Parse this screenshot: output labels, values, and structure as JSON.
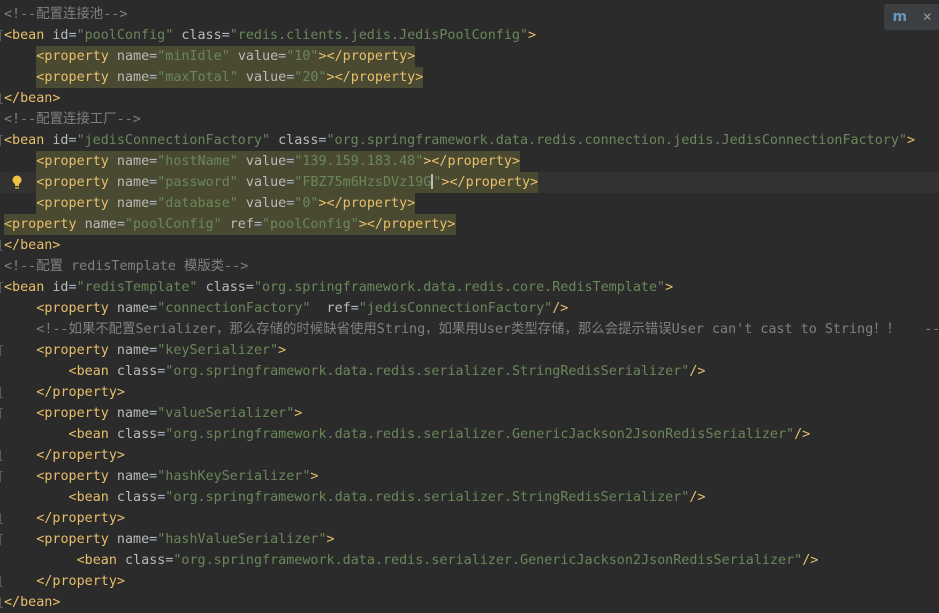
{
  "editor": {
    "lines": [
      {
        "indent": 0,
        "segs": [
          [
            "c",
            "<!--配置连接池-->"
          ]
        ]
      },
      {
        "indent": 0,
        "mark": "start",
        "segs": [
          [
            "t",
            "<bean"
          ],
          [
            "x",
            " "
          ],
          [
            "a",
            "id"
          ],
          [
            "x",
            "="
          ],
          [
            "v",
            "\"poolConfig\""
          ],
          [
            "x",
            " "
          ],
          [
            "a",
            "class"
          ],
          [
            "x",
            "="
          ],
          [
            "v",
            "\"redis.clients.jedis.JedisPoolConfig\""
          ],
          [
            "t",
            ">"
          ]
        ]
      },
      {
        "indent": 4,
        "hl": true,
        "segs": [
          [
            "t",
            "<property"
          ],
          [
            "x",
            " "
          ],
          [
            "a",
            "name"
          ],
          [
            "x",
            "="
          ],
          [
            "v",
            "\"minIdle\""
          ],
          [
            "x",
            " "
          ],
          [
            "a",
            "value"
          ],
          [
            "x",
            "="
          ],
          [
            "v",
            "\"10\""
          ],
          [
            "t",
            "></property>"
          ]
        ]
      },
      {
        "indent": 4,
        "hl": true,
        "segs": [
          [
            "t",
            "<property"
          ],
          [
            "x",
            " "
          ],
          [
            "a",
            "name"
          ],
          [
            "x",
            "="
          ],
          [
            "v",
            "\"maxTotal\""
          ],
          [
            "x",
            " "
          ],
          [
            "a",
            "value"
          ],
          [
            "x",
            "="
          ],
          [
            "v",
            "\"20\""
          ],
          [
            "t",
            "></property>"
          ]
        ]
      },
      {
        "indent": 0,
        "mark": "end",
        "segs": [
          [
            "t",
            "</bean>"
          ]
        ]
      },
      {
        "indent": 0,
        "segs": [
          [
            "c",
            "<!--配置连接工厂-->"
          ]
        ]
      },
      {
        "indent": 0,
        "mark": "start",
        "segs": [
          [
            "t",
            "<bean"
          ],
          [
            "x",
            " "
          ],
          [
            "a",
            "id"
          ],
          [
            "x",
            "="
          ],
          [
            "v",
            "\"jedisConnectionFactory\""
          ],
          [
            "x",
            " "
          ],
          [
            "a",
            "class"
          ],
          [
            "x",
            "="
          ],
          [
            "v",
            "\"org.springframework.data.redis.connection.jedis.JedisConnectionFactory\""
          ],
          [
            "t",
            ">"
          ]
        ]
      },
      {
        "indent": 4,
        "hl": true,
        "segs": [
          [
            "t",
            "<property"
          ],
          [
            "x",
            " "
          ],
          [
            "a",
            "name"
          ],
          [
            "x",
            "="
          ],
          [
            "v",
            "\"hostName\""
          ],
          [
            "x",
            " "
          ],
          [
            "a",
            "value"
          ],
          [
            "x",
            "="
          ],
          [
            "v",
            "\"139.159.183.48\""
          ],
          [
            "t",
            "></property>"
          ]
        ]
      },
      {
        "indent": 4,
        "hl": true,
        "caretRow": true,
        "bulb": true,
        "segs": [
          [
            "t",
            "<property"
          ],
          [
            "x",
            " "
          ],
          [
            "a",
            "name"
          ],
          [
            "x",
            "="
          ],
          [
            "v",
            "\"password\""
          ],
          [
            "x",
            " "
          ],
          [
            "a",
            "value"
          ],
          [
            "x",
            "="
          ],
          [
            "v",
            "\"FBZ75m6HzsDVz19G"
          ],
          [
            "caret",
            ""
          ],
          [
            "v",
            "\""
          ],
          [
            "t",
            "></property>"
          ]
        ]
      },
      {
        "indent": 4,
        "hl": true,
        "segs": [
          [
            "t",
            "<property"
          ],
          [
            "x",
            " "
          ],
          [
            "a",
            "name"
          ],
          [
            "x",
            "="
          ],
          [
            "v",
            "\"database\""
          ],
          [
            "x",
            " "
          ],
          [
            "a",
            "value"
          ],
          [
            "x",
            "="
          ],
          [
            "v",
            "\"0\""
          ],
          [
            "t",
            "></property>"
          ]
        ]
      },
      {
        "indent": 0,
        "hl": true,
        "segs": [
          [
            "t",
            "<property"
          ],
          [
            "x",
            " "
          ],
          [
            "a",
            "name"
          ],
          [
            "x",
            "="
          ],
          [
            "v",
            "\"poolConfig\""
          ],
          [
            "x",
            " "
          ],
          [
            "a",
            "ref"
          ],
          [
            "x",
            "="
          ],
          [
            "v",
            "\"poolConfig\""
          ],
          [
            "t",
            "></property>"
          ]
        ]
      },
      {
        "indent": 0,
        "mark": "end",
        "segs": [
          [
            "t",
            "</bean>"
          ]
        ]
      },
      {
        "indent": 0,
        "segs": [
          [
            "c",
            "<!--配置 redisTemplate 模版类-->"
          ]
        ]
      },
      {
        "indent": 0,
        "mark": "start",
        "segs": [
          [
            "t",
            "<bean"
          ],
          [
            "x",
            " "
          ],
          [
            "a",
            "id"
          ],
          [
            "x",
            "="
          ],
          [
            "v",
            "\"redisTemplate\""
          ],
          [
            "x",
            " "
          ],
          [
            "a",
            "class"
          ],
          [
            "x",
            "="
          ],
          [
            "v",
            "\"org.springframework.data.redis.core.RedisTemplate\""
          ],
          [
            "t",
            ">"
          ]
        ]
      },
      {
        "indent": 4,
        "segs": [
          [
            "t",
            "<property"
          ],
          [
            "x",
            " "
          ],
          [
            "a",
            "name"
          ],
          [
            "x",
            "="
          ],
          [
            "v",
            "\"connectionFactory\""
          ],
          [
            "x",
            "  "
          ],
          [
            "a",
            "ref"
          ],
          [
            "x",
            "="
          ],
          [
            "v",
            "\"jedisConnectionFactory\""
          ],
          [
            "t",
            "/>"
          ]
        ]
      },
      {
        "indent": 4,
        "segs": [
          [
            "c",
            "<!--如果不配置Serializer，那么存储的时候缺省使用String，如果用User类型存储，那么会提示错误User can't cast to String！！   -->"
          ]
        ]
      },
      {
        "indent": 4,
        "mark": "start",
        "segs": [
          [
            "t",
            "<property"
          ],
          [
            "x",
            " "
          ],
          [
            "a",
            "name"
          ],
          [
            "x",
            "="
          ],
          [
            "v",
            "\"keySerializer\""
          ],
          [
            "t",
            ">"
          ]
        ]
      },
      {
        "indent": 8,
        "segs": [
          [
            "t",
            "<bean"
          ],
          [
            "x",
            " "
          ],
          [
            "a",
            "class"
          ],
          [
            "x",
            "="
          ],
          [
            "v",
            "\"org.springframework.data.redis.serializer.StringRedisSerializer\""
          ],
          [
            "t",
            "/>"
          ]
        ]
      },
      {
        "indent": 4,
        "mark": "end",
        "segs": [
          [
            "t",
            "</property>"
          ]
        ]
      },
      {
        "indent": 4,
        "mark": "start",
        "segs": [
          [
            "t",
            "<property"
          ],
          [
            "x",
            " "
          ],
          [
            "a",
            "name"
          ],
          [
            "x",
            "="
          ],
          [
            "v",
            "\"valueSerializer\""
          ],
          [
            "t",
            ">"
          ]
        ]
      },
      {
        "indent": 8,
        "segs": [
          [
            "t",
            "<bean"
          ],
          [
            "x",
            " "
          ],
          [
            "a",
            "class"
          ],
          [
            "x",
            "="
          ],
          [
            "v",
            "\"org.springframework.data.redis.serializer.GenericJackson2JsonRedisSerializer\""
          ],
          [
            "t",
            "/>"
          ]
        ]
      },
      {
        "indent": 4,
        "mark": "end",
        "segs": [
          [
            "t",
            "</property>"
          ]
        ]
      },
      {
        "indent": 4,
        "mark": "start",
        "segs": [
          [
            "t",
            "<property"
          ],
          [
            "x",
            " "
          ],
          [
            "a",
            "name"
          ],
          [
            "x",
            "="
          ],
          [
            "v",
            "\"hashKeySerializer\""
          ],
          [
            "t",
            ">"
          ]
        ]
      },
      {
        "indent": 8,
        "segs": [
          [
            "t",
            "<bean"
          ],
          [
            "x",
            " "
          ],
          [
            "a",
            "class"
          ],
          [
            "x",
            "="
          ],
          [
            "v",
            "\"org.springframework.data.redis.serializer.StringRedisSerializer\""
          ],
          [
            "t",
            "/>"
          ]
        ]
      },
      {
        "indent": 4,
        "mark": "end",
        "segs": [
          [
            "t",
            "</property>"
          ]
        ]
      },
      {
        "indent": 4,
        "mark": "start",
        "segs": [
          [
            "t",
            "<property"
          ],
          [
            "x",
            " "
          ],
          [
            "a",
            "name"
          ],
          [
            "x",
            "="
          ],
          [
            "v",
            "\"hashValueSerializer\""
          ],
          [
            "t",
            ">"
          ]
        ]
      },
      {
        "indent": 9,
        "segs": [
          [
            "t",
            "<bean"
          ],
          [
            "x",
            " "
          ],
          [
            "a",
            "class"
          ],
          [
            "x",
            "="
          ],
          [
            "v",
            "\"org.springframework.data.redis.serializer.GenericJackson2JsonRedisSerializer\""
          ],
          [
            "t",
            "/>"
          ]
        ]
      },
      {
        "indent": 4,
        "mark": "end",
        "segs": [
          [
            "t",
            "</property>"
          ]
        ]
      },
      {
        "indent": 0,
        "mark": "end",
        "segs": [
          [
            "t",
            "</bean>"
          ]
        ]
      }
    ]
  },
  "plugin_badge": {
    "logo": "m",
    "icon": "maven-reload-icon",
    "close": "✕"
  },
  "colors": {
    "background": "#2b2b2b",
    "tag": "#e8bf6a",
    "attribute": "#bababa",
    "value": "#6a8759",
    "comment": "#808080",
    "highlight": "#4a4a32"
  }
}
